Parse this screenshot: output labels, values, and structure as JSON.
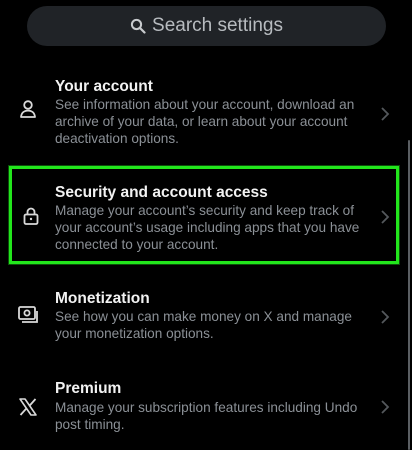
{
  "search": {
    "placeholder": "Search settings"
  },
  "settings": [
    {
      "title": "Your account",
      "description": "See information about your account, download an archive of your data, or learn about your account deactivation options.",
      "icon": "person-icon"
    },
    {
      "title": "Security and account access",
      "description": "Manage your account’s security and keep track of your account’s usage including apps that you have connected to your account.",
      "icon": "lock-icon",
      "highlighted": true
    },
    {
      "title": "Monetization",
      "description": "See how you can make money on X and manage your monetization options.",
      "icon": "money-icon"
    },
    {
      "title": "Premium",
      "description": "Manage your subscription features including Undo post timing.",
      "icon": "x-logo-icon"
    }
  ],
  "colors": {
    "background": "#000000",
    "highlight": "#22e61c",
    "title": "#f2f2f2",
    "description": "#8b9096"
  }
}
